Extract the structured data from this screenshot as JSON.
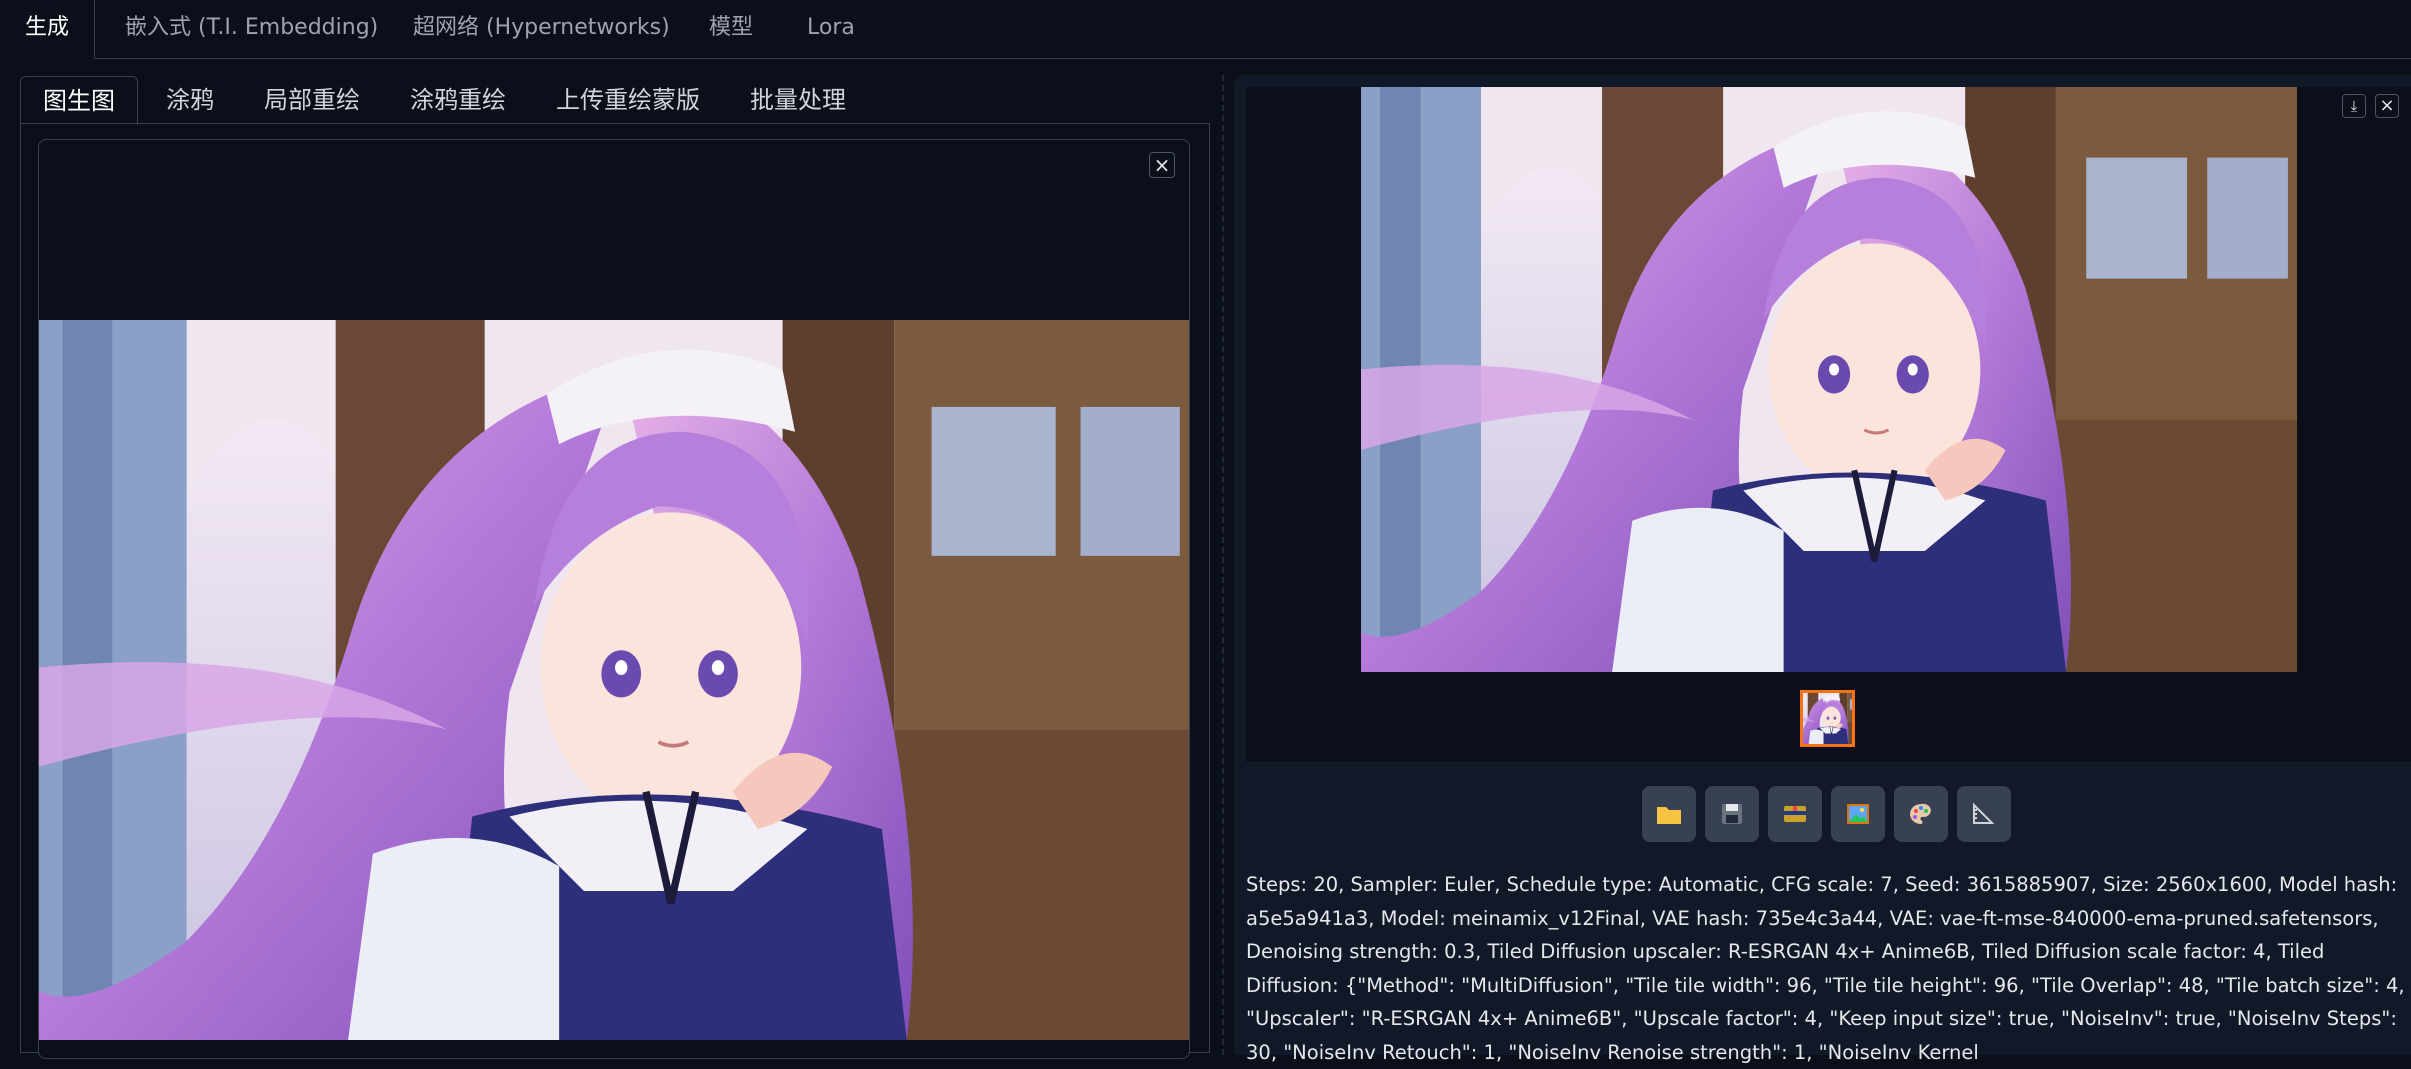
{
  "top_tabs": [
    "生成",
    "嵌入式 (T.I. Embedding)",
    "超网络 (Hypernetworks)",
    "模型",
    "Lora"
  ],
  "sub_tabs": [
    "图生图",
    "涂鸦",
    "局部重绘",
    "涂鸦重绘",
    "上传重绘蒙版",
    "批量处理"
  ],
  "input_image": {
    "close_symbol": "×"
  },
  "output": {
    "download_symbol": "⤓",
    "close_symbol": "×",
    "toolbar": [
      "folder-icon",
      "save-icon",
      "zip-icon",
      "image-icon",
      "palette-icon",
      "ruler-icon"
    ],
    "generation_info": "Steps: 20, Sampler: Euler, Schedule type: Automatic, CFG scale: 7, Seed: 3615885907, Size: 2560x1600, Model hash: a5e5a941a3, Model: meinamix_v12Final, VAE hash: 735e4c3a44, VAE: vae-ft-mse-840000-ema-pruned.safetensors, Denoising strength: 0.3, Tiled Diffusion upscaler: R-ESRGAN 4x+ Anime6B, Tiled Diffusion scale factor: 4, Tiled Diffusion: {\"Method\": \"MultiDiffusion\", \"Tile tile width\": 96, \"Tile tile height\": 96, \"Tile Overlap\": 48, \"Tile batch size\": 4, \"Upscaler\": \"R-ESRGAN 4x+ Anime6B\", \"Upscale factor\": 4, \"Keep input size\": true, \"NoiseInv\": true, \"NoiseInv Steps\": 30, \"NoiseInv Retouch\": 1, \"NoiseInv Renoise strength\": 1, \"NoiseInv Kernel"
  },
  "colors": {
    "background": "#0b0f19",
    "panel": "#111827",
    "border": "#374151",
    "accent": "#f97316"
  }
}
